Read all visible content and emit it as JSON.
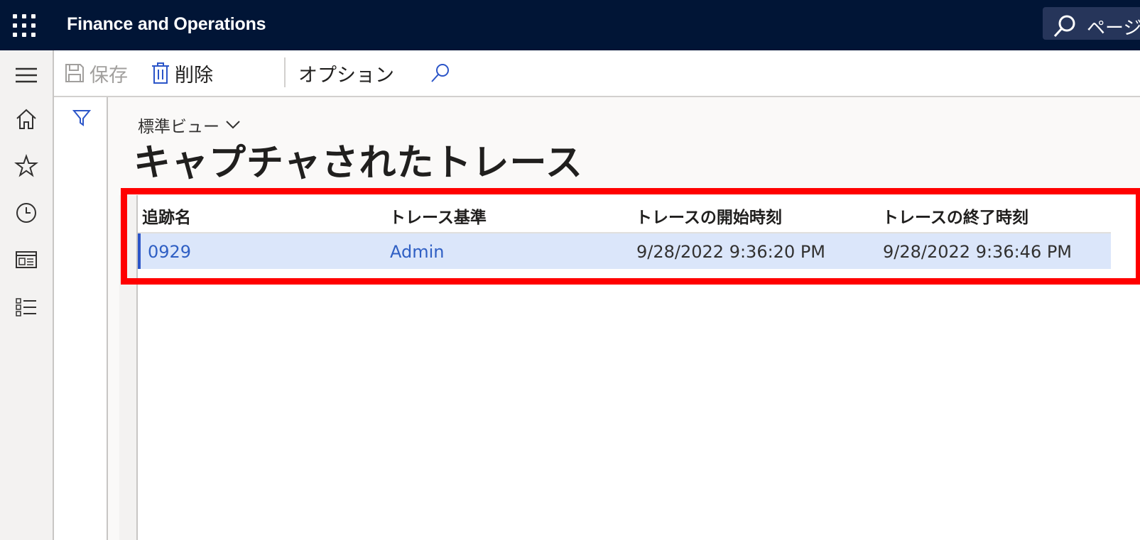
{
  "app": {
    "title": "Finance and Operations"
  },
  "search": {
    "label": "ページ"
  },
  "toolbar": {
    "save_label": "保存",
    "delete_label": "削除",
    "options_label": "オプション"
  },
  "view": {
    "name": "標準ビュー"
  },
  "page": {
    "title": "キャプチャされたトレース"
  },
  "grid": {
    "columns": [
      "追跡名",
      "トレース基準",
      "トレースの開始時刻",
      "トレースの終了時刻"
    ],
    "rows": [
      {
        "name": "0929",
        "basis": "Admin",
        "start": "9/28/2022 9:36:20 PM",
        "end": "9/28/2022 9:36:46 PM"
      }
    ]
  },
  "colors": {
    "topbar": "#011536",
    "selected_row": "#dbe6fa",
    "link": "#2f5fc4",
    "highlight": "#ff0000"
  },
  "icons": [
    "app-launcher-icon",
    "search-icon",
    "menu-icon",
    "home-icon",
    "star-icon",
    "clock-icon",
    "workspace-icon",
    "list-icon",
    "save-icon",
    "delete-icon",
    "filter-icon",
    "chevron-down-icon"
  ]
}
